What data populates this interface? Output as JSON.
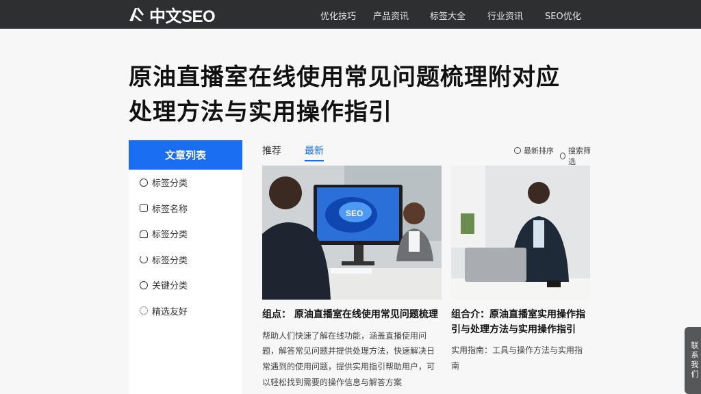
{
  "header": {
    "logo_text": "中文SEO",
    "nav": [
      "优化技巧",
      "产品资讯",
      "标签大全",
      "行业资讯",
      "SEO优化"
    ]
  },
  "article": {
    "title": "原油直播室在线使用常见问题梳理附对应处理方法与实用操作指引"
  },
  "sidebar": {
    "heading": "文章列表",
    "items": [
      {
        "label": "标签分类",
        "icon": "clock-icon"
      },
      {
        "label": "标签名称",
        "icon": "tag-icon"
      },
      {
        "label": "标签分类",
        "icon": "user-icon"
      },
      {
        "label": "标签分类",
        "icon": "refresh-icon"
      },
      {
        "label": "关键分类",
        "icon": "info-icon"
      },
      {
        "label": "精选友好",
        "icon": "settings-icon"
      }
    ]
  },
  "tabs": {
    "items": [
      "推荐",
      "最新"
    ],
    "active_index": 1,
    "filters": [
      "最新排序",
      "搜索筛选"
    ]
  },
  "cards": [
    {
      "image_alt_label": "SEO",
      "title": "组点： 原油直播室在线使用常见问题梳理",
      "desc": "帮助人们快速了解在线功能，涵盖直播使用问题，解答常见问题并提供处理方法，快速解决日常遇到的使用问题，提供实用指引帮助用户，可以轻松找到需要的操作信息与解答方案"
    },
    {
      "title": "组合介：原油直播室实用操作指引与处理方法与实用操作指引",
      "desc": "实用指南：工具与操作方法与实用指南"
    }
  ],
  "float_button": {
    "label": "联系我们"
  },
  "colors": {
    "topbar": "#2e2f31",
    "accent": "#1a6ef2",
    "page_bg": "#f7f7f8"
  }
}
